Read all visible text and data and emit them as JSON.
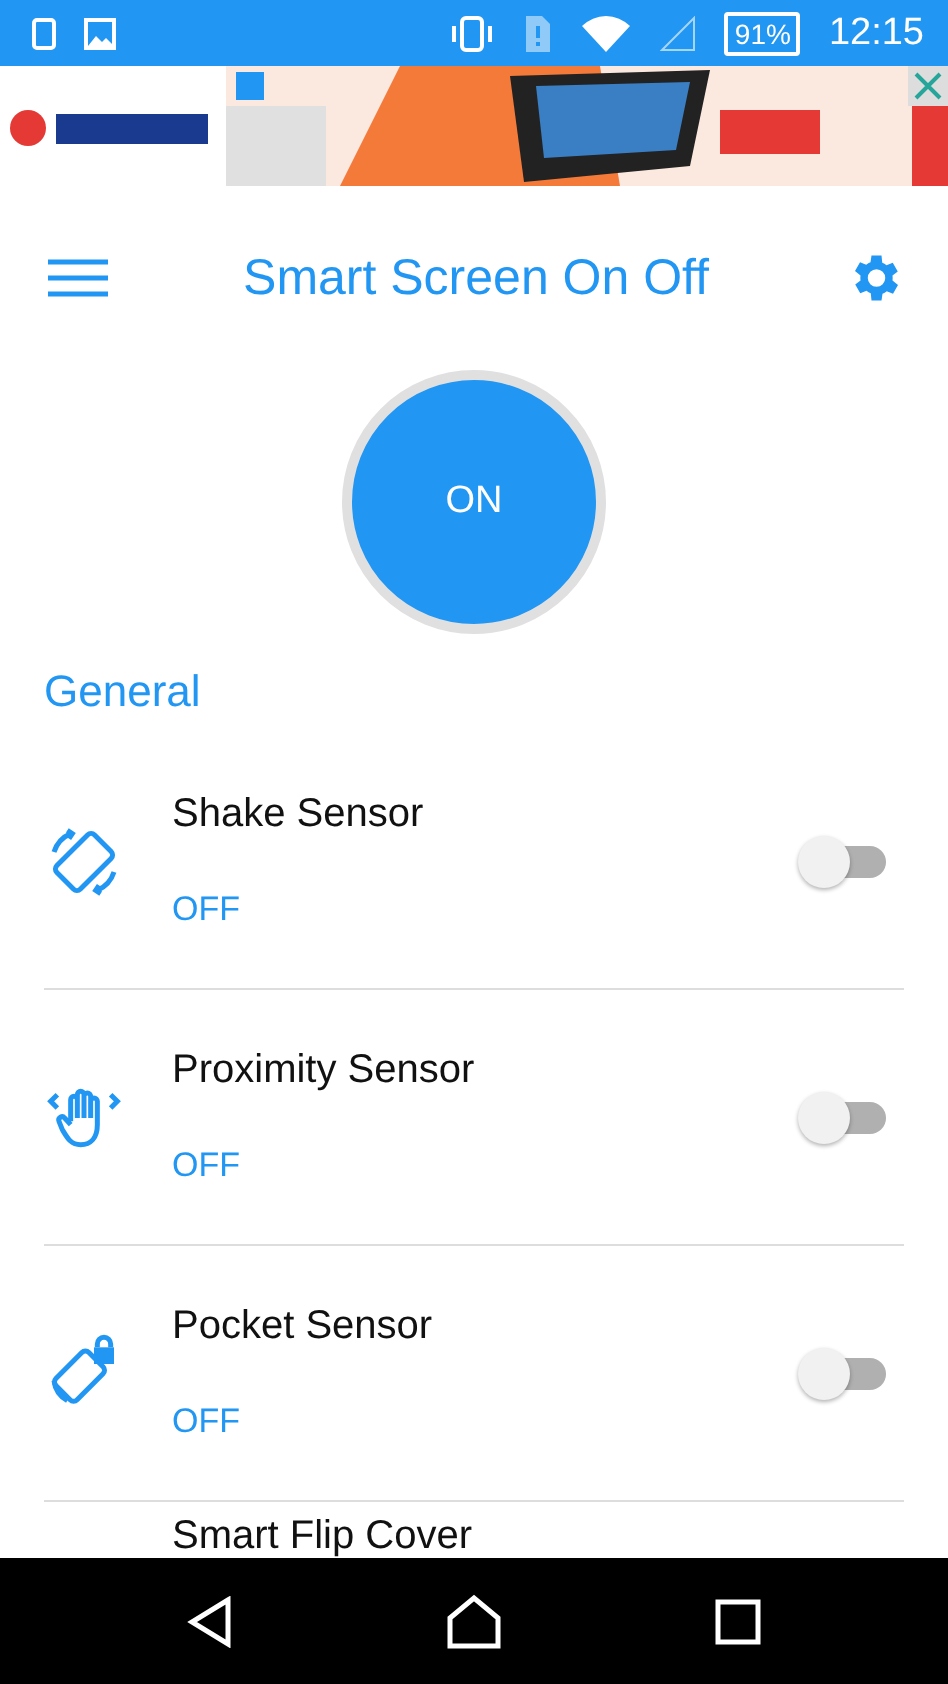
{
  "status_bar": {
    "time": "12:15",
    "battery": "91%"
  },
  "app_bar": {
    "title": "Smart Screen On Off"
  },
  "power_button": {
    "label": "ON",
    "on": true
  },
  "section": {
    "title": "General"
  },
  "sensors": [
    {
      "kind": "shake",
      "name": "Shake Sensor",
      "status": "OFF",
      "on": false
    },
    {
      "kind": "proximity",
      "name": "Proximity Sensor",
      "status": "OFF",
      "on": false
    },
    {
      "kind": "pocket",
      "name": "Pocket Sensor",
      "status": "OFF",
      "on": false
    },
    {
      "kind": "flip",
      "name": "Smart Flip Cover"
    }
  ]
}
